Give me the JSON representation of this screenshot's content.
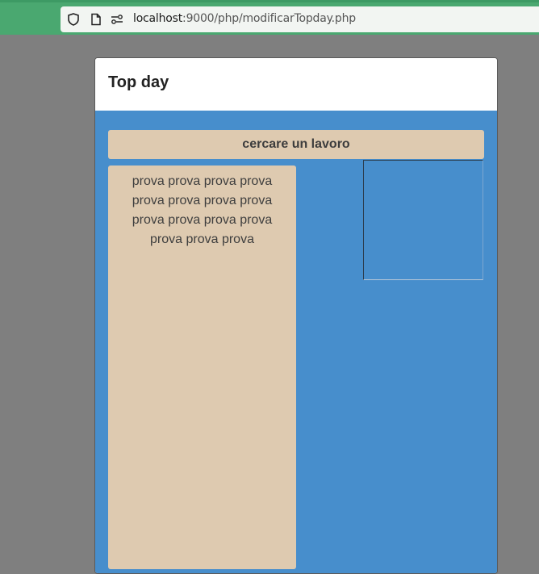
{
  "browser": {
    "url_host": "localhost",
    "url_port_path": ":9000/php/modificarTopday.php",
    "icons": [
      "shield-icon",
      "page-icon",
      "connection-settings-icon"
    ]
  },
  "modal": {
    "title": "Top day",
    "search_button_label": "cercare un lavoro",
    "card_text": "prova prova prova prova prova prova prova prova prova prova prova prova prova prova prova"
  },
  "colors": {
    "browser_bar": "#4aa870",
    "backdrop": "#7f7f7f",
    "body_bg": "#478ecc",
    "card_bg": "#decab0"
  }
}
